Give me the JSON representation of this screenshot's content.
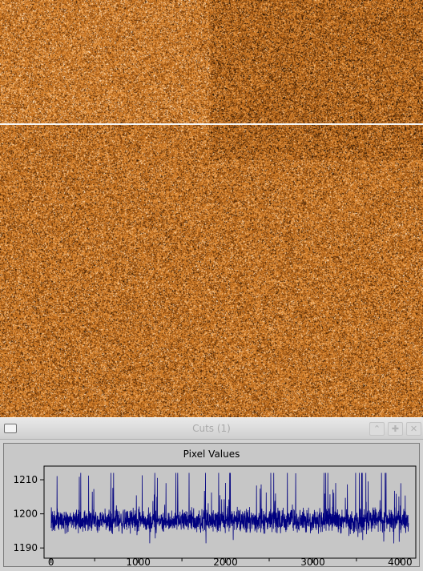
{
  "image_display": {
    "colormap": [
      "#000000",
      "#7a3e0c",
      "#c8731f",
      "#f0a04a",
      "#fff6e6"
    ]
  },
  "cuts_window": {
    "title": "Cuts (1)",
    "buttons": [
      {
        "name": "minimize",
        "icon": "chevron-up-icon",
        "glyph": "⌃"
      },
      {
        "name": "maximize",
        "icon": "plus-icon",
        "glyph": "✚"
      },
      {
        "name": "close",
        "icon": "close-icon",
        "glyph": "✕"
      }
    ]
  },
  "chart_data": {
    "type": "line",
    "title": "Pixel Values",
    "xlabel": "",
    "ylabel": "",
    "xlim": [
      -80,
      4180
    ],
    "ylim": [
      1187,
      1214
    ],
    "x_ticks": [
      0,
      1000,
      2000,
      3000,
      4000
    ],
    "y_ticks": [
      1190,
      1200,
      1210
    ],
    "grid": false,
    "line_color": "#00007f",
    "series": [
      {
        "x_range": [
          0,
          4096
        ],
        "baseline": 1198,
        "noise_range": [
          1189,
          1212
        ]
      }
    ]
  }
}
